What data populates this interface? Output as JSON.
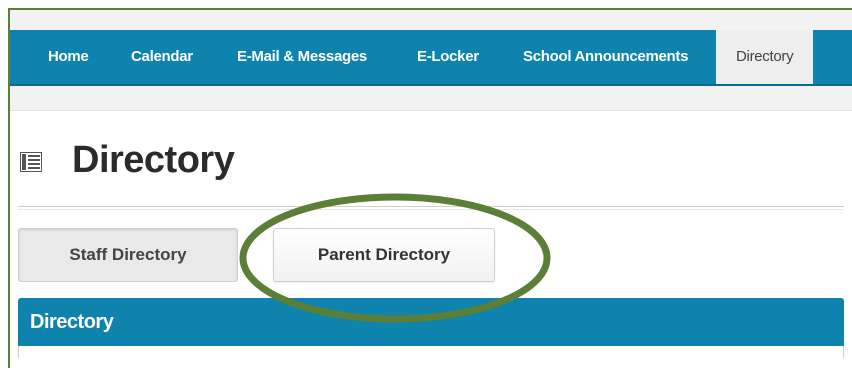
{
  "nav": {
    "items": [
      {
        "label": "Home"
      },
      {
        "label": "Calendar"
      },
      {
        "label": "E-Mail & Messages"
      },
      {
        "label": "E-Locker"
      },
      {
        "label": "School Announcements"
      },
      {
        "label": "Directory",
        "active": true
      }
    ]
  },
  "page": {
    "title": "Directory",
    "icon": "directory-list-icon"
  },
  "tabs": {
    "staff_label": "Staff Directory",
    "parent_label": "Parent Directory"
  },
  "panel": {
    "title": "Directory"
  },
  "colors": {
    "nav_blue": "#0d83ad",
    "highlight_green": "#5b7f37"
  }
}
